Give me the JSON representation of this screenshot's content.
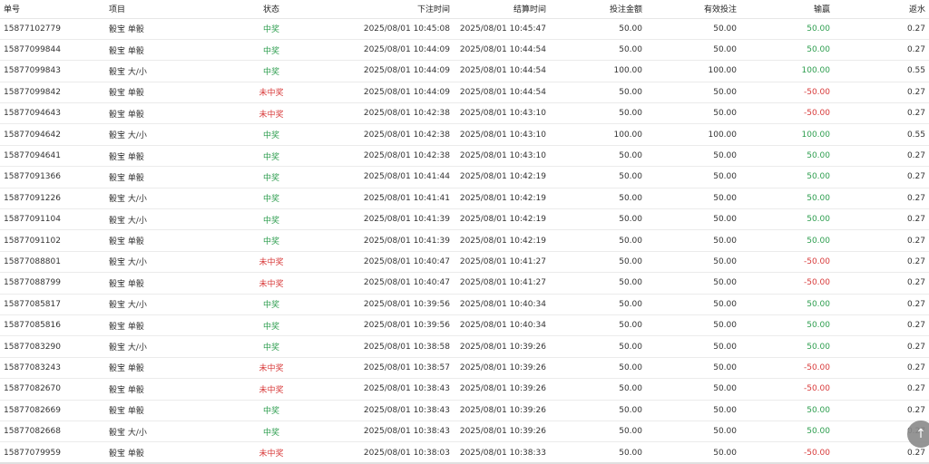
{
  "colors": {
    "win": "#2e9e4f",
    "lose": "#d83a3a"
  },
  "table": {
    "headers": {
      "id": "单号",
      "item": "项目",
      "status": "状态",
      "bet_time": "下注时间",
      "settle_time": "结算时间",
      "amount": "投注金额",
      "valid": "有效投注",
      "win_loss": "输赢",
      "rebate": "返水"
    },
    "rows": [
      {
        "id": "15877102779",
        "item": "骰宝 单骰",
        "status": "中奖",
        "win": true,
        "bet_time": "2025/08/01 10:45:08",
        "settle_time": "2025/08/01 10:45:47",
        "amount": "50.00",
        "valid": "50.00",
        "win_loss": "50.00",
        "rebate": "0.27"
      },
      {
        "id": "15877099844",
        "item": "骰宝 单骰",
        "status": "中奖",
        "win": true,
        "bet_time": "2025/08/01 10:44:09",
        "settle_time": "2025/08/01 10:44:54",
        "amount": "50.00",
        "valid": "50.00",
        "win_loss": "50.00",
        "rebate": "0.27"
      },
      {
        "id": "15877099843",
        "item": "骰宝 大/小",
        "status": "中奖",
        "win": true,
        "bet_time": "2025/08/01 10:44:09",
        "settle_time": "2025/08/01 10:44:54",
        "amount": "100.00",
        "valid": "100.00",
        "win_loss": "100.00",
        "rebate": "0.55"
      },
      {
        "id": "15877099842",
        "item": "骰宝 单骰",
        "status": "未中奖",
        "win": false,
        "bet_time": "2025/08/01 10:44:09",
        "settle_time": "2025/08/01 10:44:54",
        "amount": "50.00",
        "valid": "50.00",
        "win_loss": "-50.00",
        "rebate": "0.27"
      },
      {
        "id": "15877094643",
        "item": "骰宝 单骰",
        "status": "未中奖",
        "win": false,
        "bet_time": "2025/08/01 10:42:38",
        "settle_time": "2025/08/01 10:43:10",
        "amount": "50.00",
        "valid": "50.00",
        "win_loss": "-50.00",
        "rebate": "0.27"
      },
      {
        "id": "15877094642",
        "item": "骰宝 大/小",
        "status": "中奖",
        "win": true,
        "bet_time": "2025/08/01 10:42:38",
        "settle_time": "2025/08/01 10:43:10",
        "amount": "100.00",
        "valid": "100.00",
        "win_loss": "100.00",
        "rebate": "0.55"
      },
      {
        "id": "15877094641",
        "item": "骰宝 单骰",
        "status": "中奖",
        "win": true,
        "bet_time": "2025/08/01 10:42:38",
        "settle_time": "2025/08/01 10:43:10",
        "amount": "50.00",
        "valid": "50.00",
        "win_loss": "50.00",
        "rebate": "0.27"
      },
      {
        "id": "15877091366",
        "item": "骰宝 单骰",
        "status": "中奖",
        "win": true,
        "bet_time": "2025/08/01 10:41:44",
        "settle_time": "2025/08/01 10:42:19",
        "amount": "50.00",
        "valid": "50.00",
        "win_loss": "50.00",
        "rebate": "0.27"
      },
      {
        "id": "15877091226",
        "item": "骰宝 大/小",
        "status": "中奖",
        "win": true,
        "bet_time": "2025/08/01 10:41:41",
        "settle_time": "2025/08/01 10:42:19",
        "amount": "50.00",
        "valid": "50.00",
        "win_loss": "50.00",
        "rebate": "0.27"
      },
      {
        "id": "15877091104",
        "item": "骰宝 大/小",
        "status": "中奖",
        "win": true,
        "bet_time": "2025/08/01 10:41:39",
        "settle_time": "2025/08/01 10:42:19",
        "amount": "50.00",
        "valid": "50.00",
        "win_loss": "50.00",
        "rebate": "0.27"
      },
      {
        "id": "15877091102",
        "item": "骰宝 单骰",
        "status": "中奖",
        "win": true,
        "bet_time": "2025/08/01 10:41:39",
        "settle_time": "2025/08/01 10:42:19",
        "amount": "50.00",
        "valid": "50.00",
        "win_loss": "50.00",
        "rebate": "0.27"
      },
      {
        "id": "15877088801",
        "item": "骰宝 大/小",
        "status": "未中奖",
        "win": false,
        "bet_time": "2025/08/01 10:40:47",
        "settle_time": "2025/08/01 10:41:27",
        "amount": "50.00",
        "valid": "50.00",
        "win_loss": "-50.00",
        "rebate": "0.27"
      },
      {
        "id": "15877088799",
        "item": "骰宝 单骰",
        "status": "未中奖",
        "win": false,
        "bet_time": "2025/08/01 10:40:47",
        "settle_time": "2025/08/01 10:41:27",
        "amount": "50.00",
        "valid": "50.00",
        "win_loss": "-50.00",
        "rebate": "0.27"
      },
      {
        "id": "15877085817",
        "item": "骰宝 大/小",
        "status": "中奖",
        "win": true,
        "bet_time": "2025/08/01 10:39:56",
        "settle_time": "2025/08/01 10:40:34",
        "amount": "50.00",
        "valid": "50.00",
        "win_loss": "50.00",
        "rebate": "0.27"
      },
      {
        "id": "15877085816",
        "item": "骰宝 单骰",
        "status": "中奖",
        "win": true,
        "bet_time": "2025/08/01 10:39:56",
        "settle_time": "2025/08/01 10:40:34",
        "amount": "50.00",
        "valid": "50.00",
        "win_loss": "50.00",
        "rebate": "0.27"
      },
      {
        "id": "15877083290",
        "item": "骰宝 大/小",
        "status": "中奖",
        "win": true,
        "bet_time": "2025/08/01 10:38:58",
        "settle_time": "2025/08/01 10:39:26",
        "amount": "50.00",
        "valid": "50.00",
        "win_loss": "50.00",
        "rebate": "0.27"
      },
      {
        "id": "15877083243",
        "item": "骰宝 单骰",
        "status": "未中奖",
        "win": false,
        "bet_time": "2025/08/01 10:38:57",
        "settle_time": "2025/08/01 10:39:26",
        "amount": "50.00",
        "valid": "50.00",
        "win_loss": "-50.00",
        "rebate": "0.27"
      },
      {
        "id": "15877082670",
        "item": "骰宝 单骰",
        "status": "未中奖",
        "win": false,
        "bet_time": "2025/08/01 10:38:43",
        "settle_time": "2025/08/01 10:39:26",
        "amount": "50.00",
        "valid": "50.00",
        "win_loss": "-50.00",
        "rebate": "0.27"
      },
      {
        "id": "15877082669",
        "item": "骰宝 单骰",
        "status": "中奖",
        "win": true,
        "bet_time": "2025/08/01 10:38:43",
        "settle_time": "2025/08/01 10:39:26",
        "amount": "50.00",
        "valid": "50.00",
        "win_loss": "50.00",
        "rebate": "0.27"
      },
      {
        "id": "15877082668",
        "item": "骰宝 大/小",
        "status": "中奖",
        "win": true,
        "bet_time": "2025/08/01 10:38:43",
        "settle_time": "2025/08/01 10:39:26",
        "amount": "50.00",
        "valid": "50.00",
        "win_loss": "50.00",
        "rebate": "0.27"
      },
      {
        "id": "15877079959",
        "item": "骰宝 单骰",
        "status": "未中奖",
        "win": false,
        "bet_time": "2025/08/01 10:38:03",
        "settle_time": "2025/08/01 10:38:33",
        "amount": "50.00",
        "valid": "50.00",
        "win_loss": "-50.00",
        "rebate": "0.27"
      }
    ]
  },
  "scroll_top_icon": "arrow-up-icon"
}
